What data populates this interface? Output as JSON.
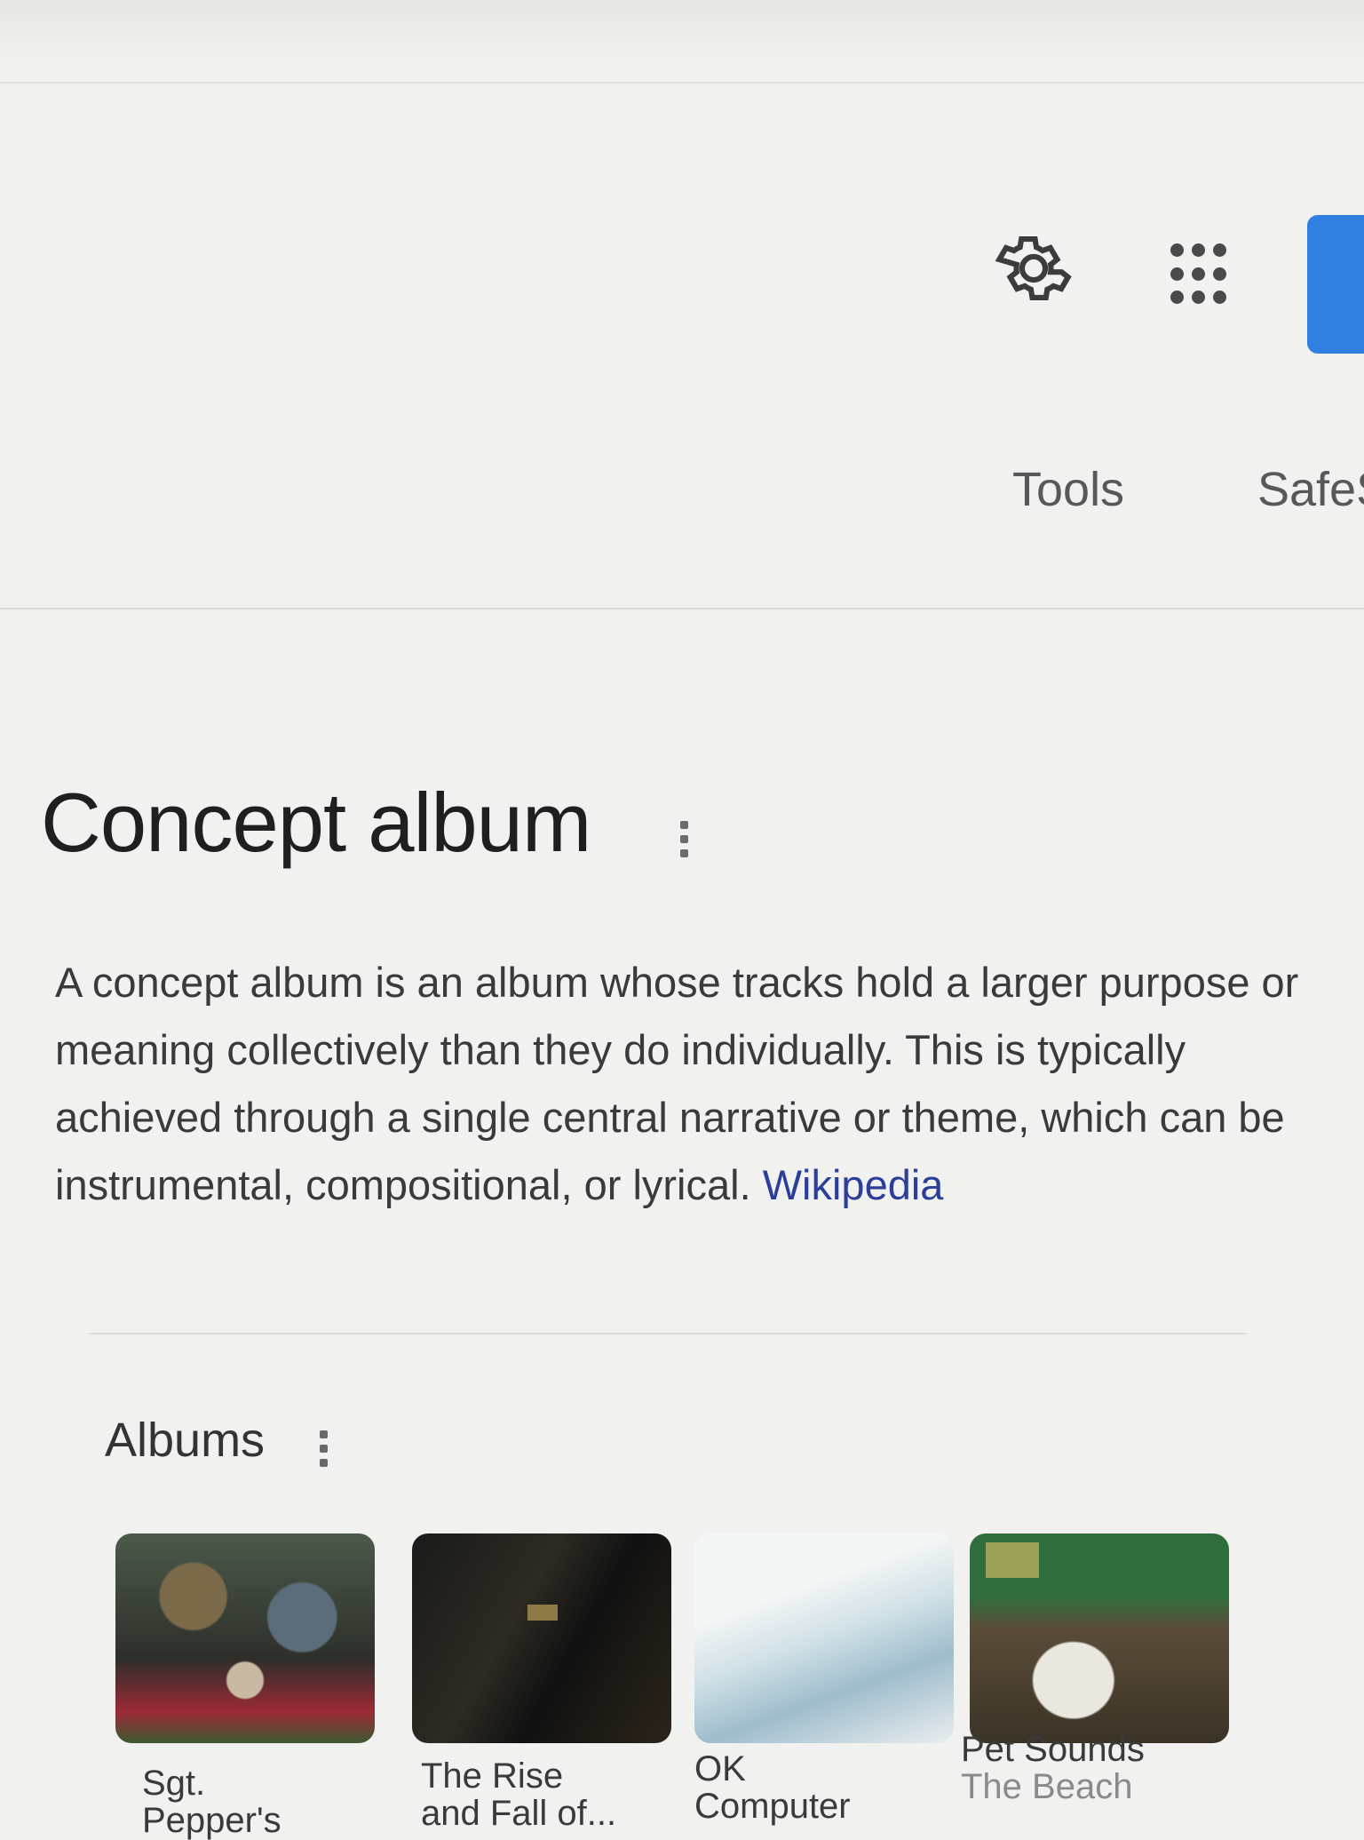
{
  "header": {
    "settings_icon": "gear-icon",
    "apps_icon": "apps-grid-icon",
    "nav": {
      "tools": "Tools",
      "safe": "SafeS"
    }
  },
  "knowledge_panel": {
    "title": "Concept album",
    "description": "A concept album is an album whose tracks hold a larger purpose or meaning collectively than they do individually. This is typically achieved through a single central narrative or theme, which can be instrumental, compositional, or lyrical.",
    "source_link": "Wikipedia",
    "albums_heading": "Albums",
    "albums": [
      {
        "title_line1": "Sgt.",
        "title_line2": "Pepper's"
      },
      {
        "title_line1": "The Rise",
        "title_line2": "and Fall of..."
      },
      {
        "title_line1": "OK",
        "title_line2": "Computer"
      },
      {
        "title_line1": "Pet Sounds",
        "title_line2": "The Beach"
      }
    ]
  },
  "colors": {
    "accent_blue": "#2f7fe0",
    "link": "#2b3e9a"
  }
}
